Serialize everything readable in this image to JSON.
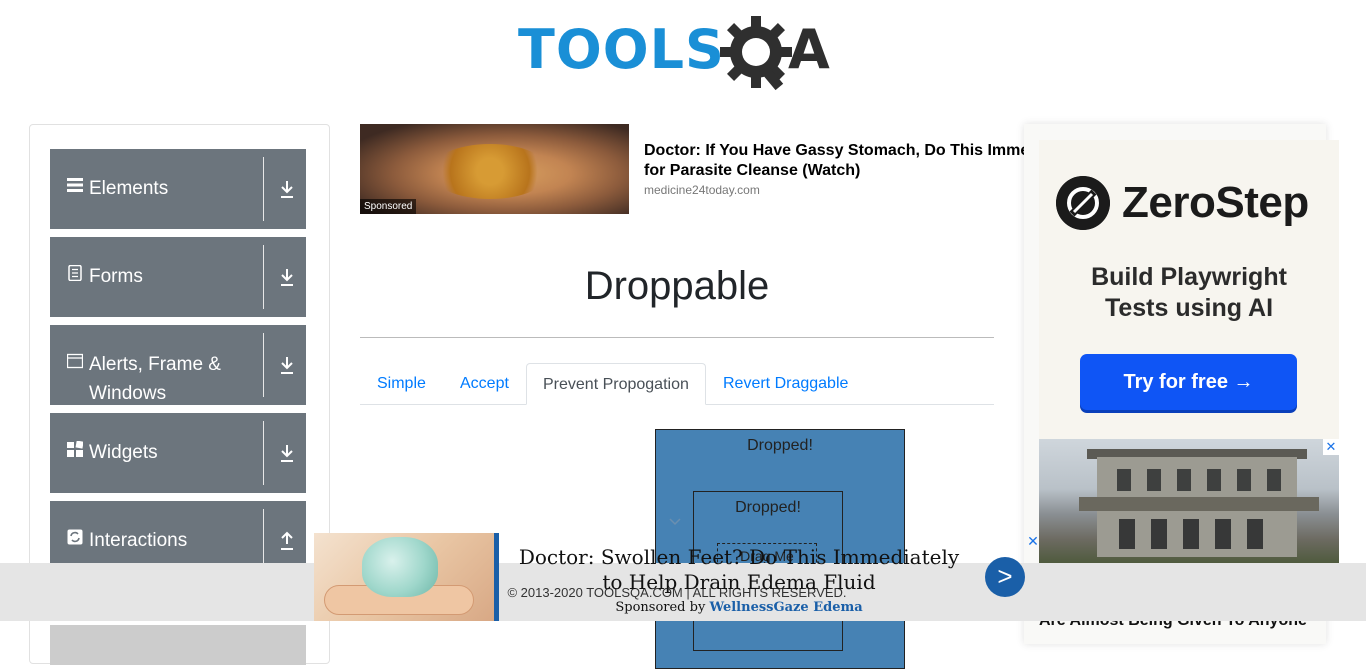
{
  "header": {
    "logo_text": "TOOLSQA"
  },
  "sidebar": {
    "groups": [
      {
        "label": "Elements",
        "icon": "menu-icon",
        "arrow": "down"
      },
      {
        "label": "Forms",
        "icon": "document-icon",
        "arrow": "down"
      },
      {
        "label": "Alerts, Frame & Windows",
        "icon": "window-icon",
        "arrow": "down"
      },
      {
        "label": "Widgets",
        "icon": "widgets-icon",
        "arrow": "down"
      },
      {
        "label": "Interactions",
        "icon": "interactions-icon",
        "arrow": "up"
      }
    ]
  },
  "top_ad": {
    "badge": "Sponsored",
    "title_line1": "Doctor: If You Have Gassy Stomach, Do This Immed",
    "title_line2": "for Parasite Cleanse (Watch)",
    "source": "medicine24today.com"
  },
  "main": {
    "title": "Droppable",
    "tabs": [
      {
        "label": "Simple",
        "active": false
      },
      {
        "label": "Accept",
        "active": false
      },
      {
        "label": "Prevent Propogation",
        "active": true
      },
      {
        "label": "Revert Draggable",
        "active": false
      }
    ],
    "outer_drop_text": "Dropped!",
    "inner_drop_text": "Dropped!",
    "drag_text": "Drag Me"
  },
  "right_ad": {
    "brand": "ZeroStep",
    "tagline_line1": "Build Playwright",
    "tagline_line2": "Tests using AI",
    "cta": "Try for free →",
    "partial_text": "Are Almost Being Given To Anyone"
  },
  "footer": {
    "text": "© 2013-2020 TOOLSQA.COM | ALL RIGHTS RESERVED."
  },
  "bottom_ad": {
    "title_line1": "Doctor: Swollen Feet? Do This Immediately",
    "title_line2": "to Help Drain Edema Fluid",
    "sponsored_prefix": "Sponsored by",
    "sponsor": "WellnessGaze Edema",
    "go": ">",
    "close": "✕"
  },
  "colors": {
    "sidebar_group": "#6c757d",
    "drop_blue": "#4682b4",
    "link": "#007bff",
    "cta_blue": "#0f55f5"
  }
}
